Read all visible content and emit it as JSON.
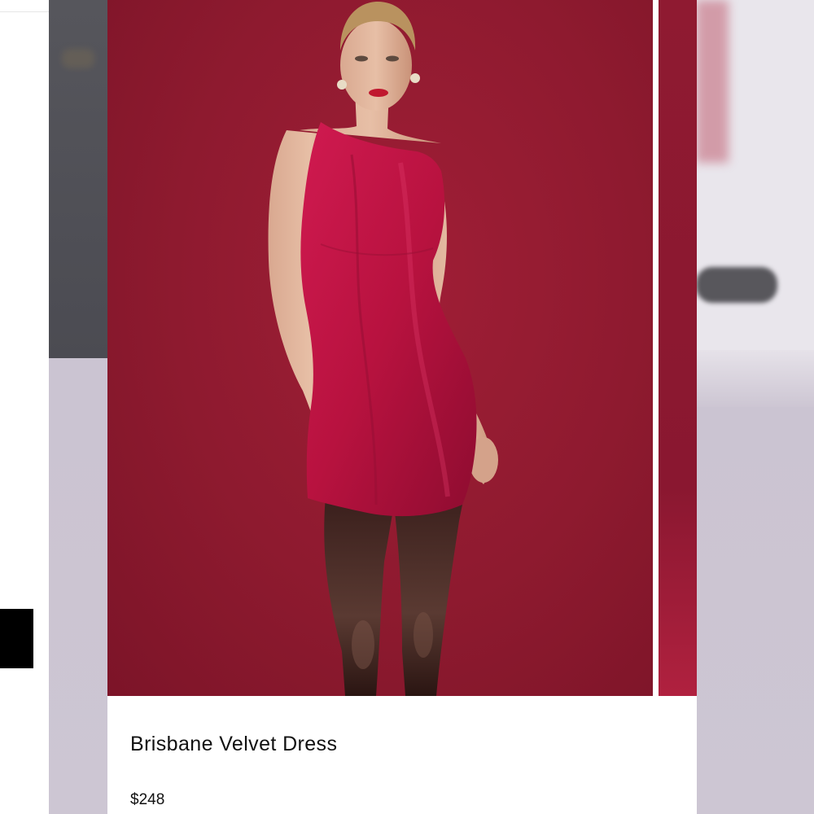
{
  "product": {
    "name": "Brisbane Velvet Dress",
    "price": "$248",
    "image_icon": "model-in-red-velvet-dress-photo"
  },
  "colors": {
    "backdrop": "#8e1a2f",
    "dress": "#c01545",
    "card": "#ffffff",
    "text": "#111111"
  }
}
